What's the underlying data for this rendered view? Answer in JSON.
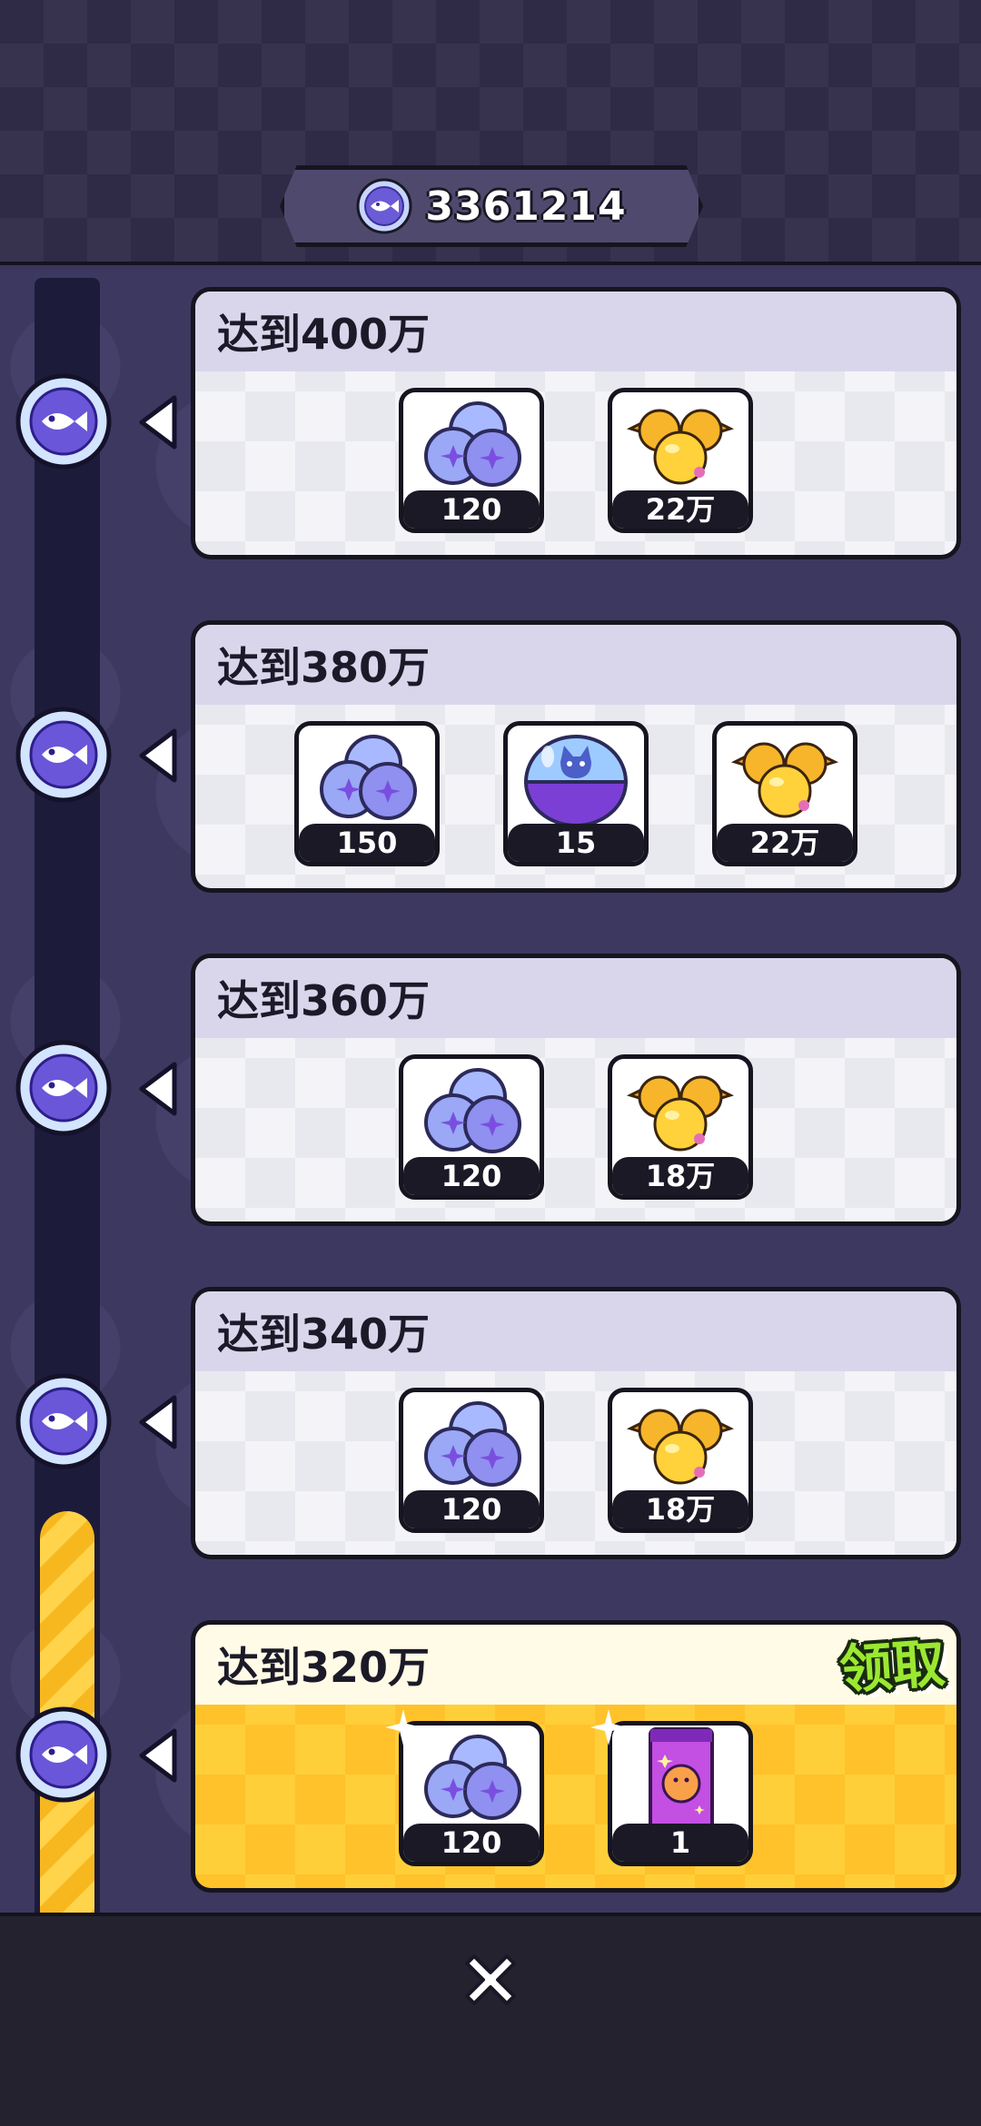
{
  "header": {
    "score": "3361214",
    "score_icon": "fish-coin-icon"
  },
  "milestones": [
    {
      "title": "达到400万",
      "state": "locked",
      "rewards": [
        {
          "icon": "gem-orbs-icon",
          "qty": "120"
        },
        {
          "icon": "gold-candy-icon",
          "qty": "22万"
        }
      ]
    },
    {
      "title": "达到380万",
      "state": "locked",
      "rewards": [
        {
          "icon": "gem-orbs-icon",
          "qty": "150"
        },
        {
          "icon": "capsule-egg-icon",
          "qty": "15"
        },
        {
          "icon": "gold-candy-icon",
          "qty": "22万"
        }
      ]
    },
    {
      "title": "达到360万",
      "state": "locked",
      "rewards": [
        {
          "icon": "gem-orbs-icon",
          "qty": "120"
        },
        {
          "icon": "gold-candy-icon",
          "qty": "18万"
        }
      ]
    },
    {
      "title": "达到340万",
      "state": "locked",
      "rewards": [
        {
          "icon": "gem-orbs-icon",
          "qty": "120"
        },
        {
          "icon": "gold-candy-icon",
          "qty": "18万"
        }
      ]
    },
    {
      "title": "达到320万",
      "state": "claimable",
      "rewards": [
        {
          "icon": "gem-orbs-icon",
          "qty": "120"
        },
        {
          "icon": "card-pack-icon",
          "qty": "1"
        }
      ]
    }
  ],
  "claim_label": "领取",
  "close_icon": "close-icon",
  "colors": {
    "progress_fill": "#f7b81f",
    "claim_text": "#9be831",
    "card_locked_header": "#d9d6ec",
    "card_claimable_bg": "#ffcf3a"
  }
}
